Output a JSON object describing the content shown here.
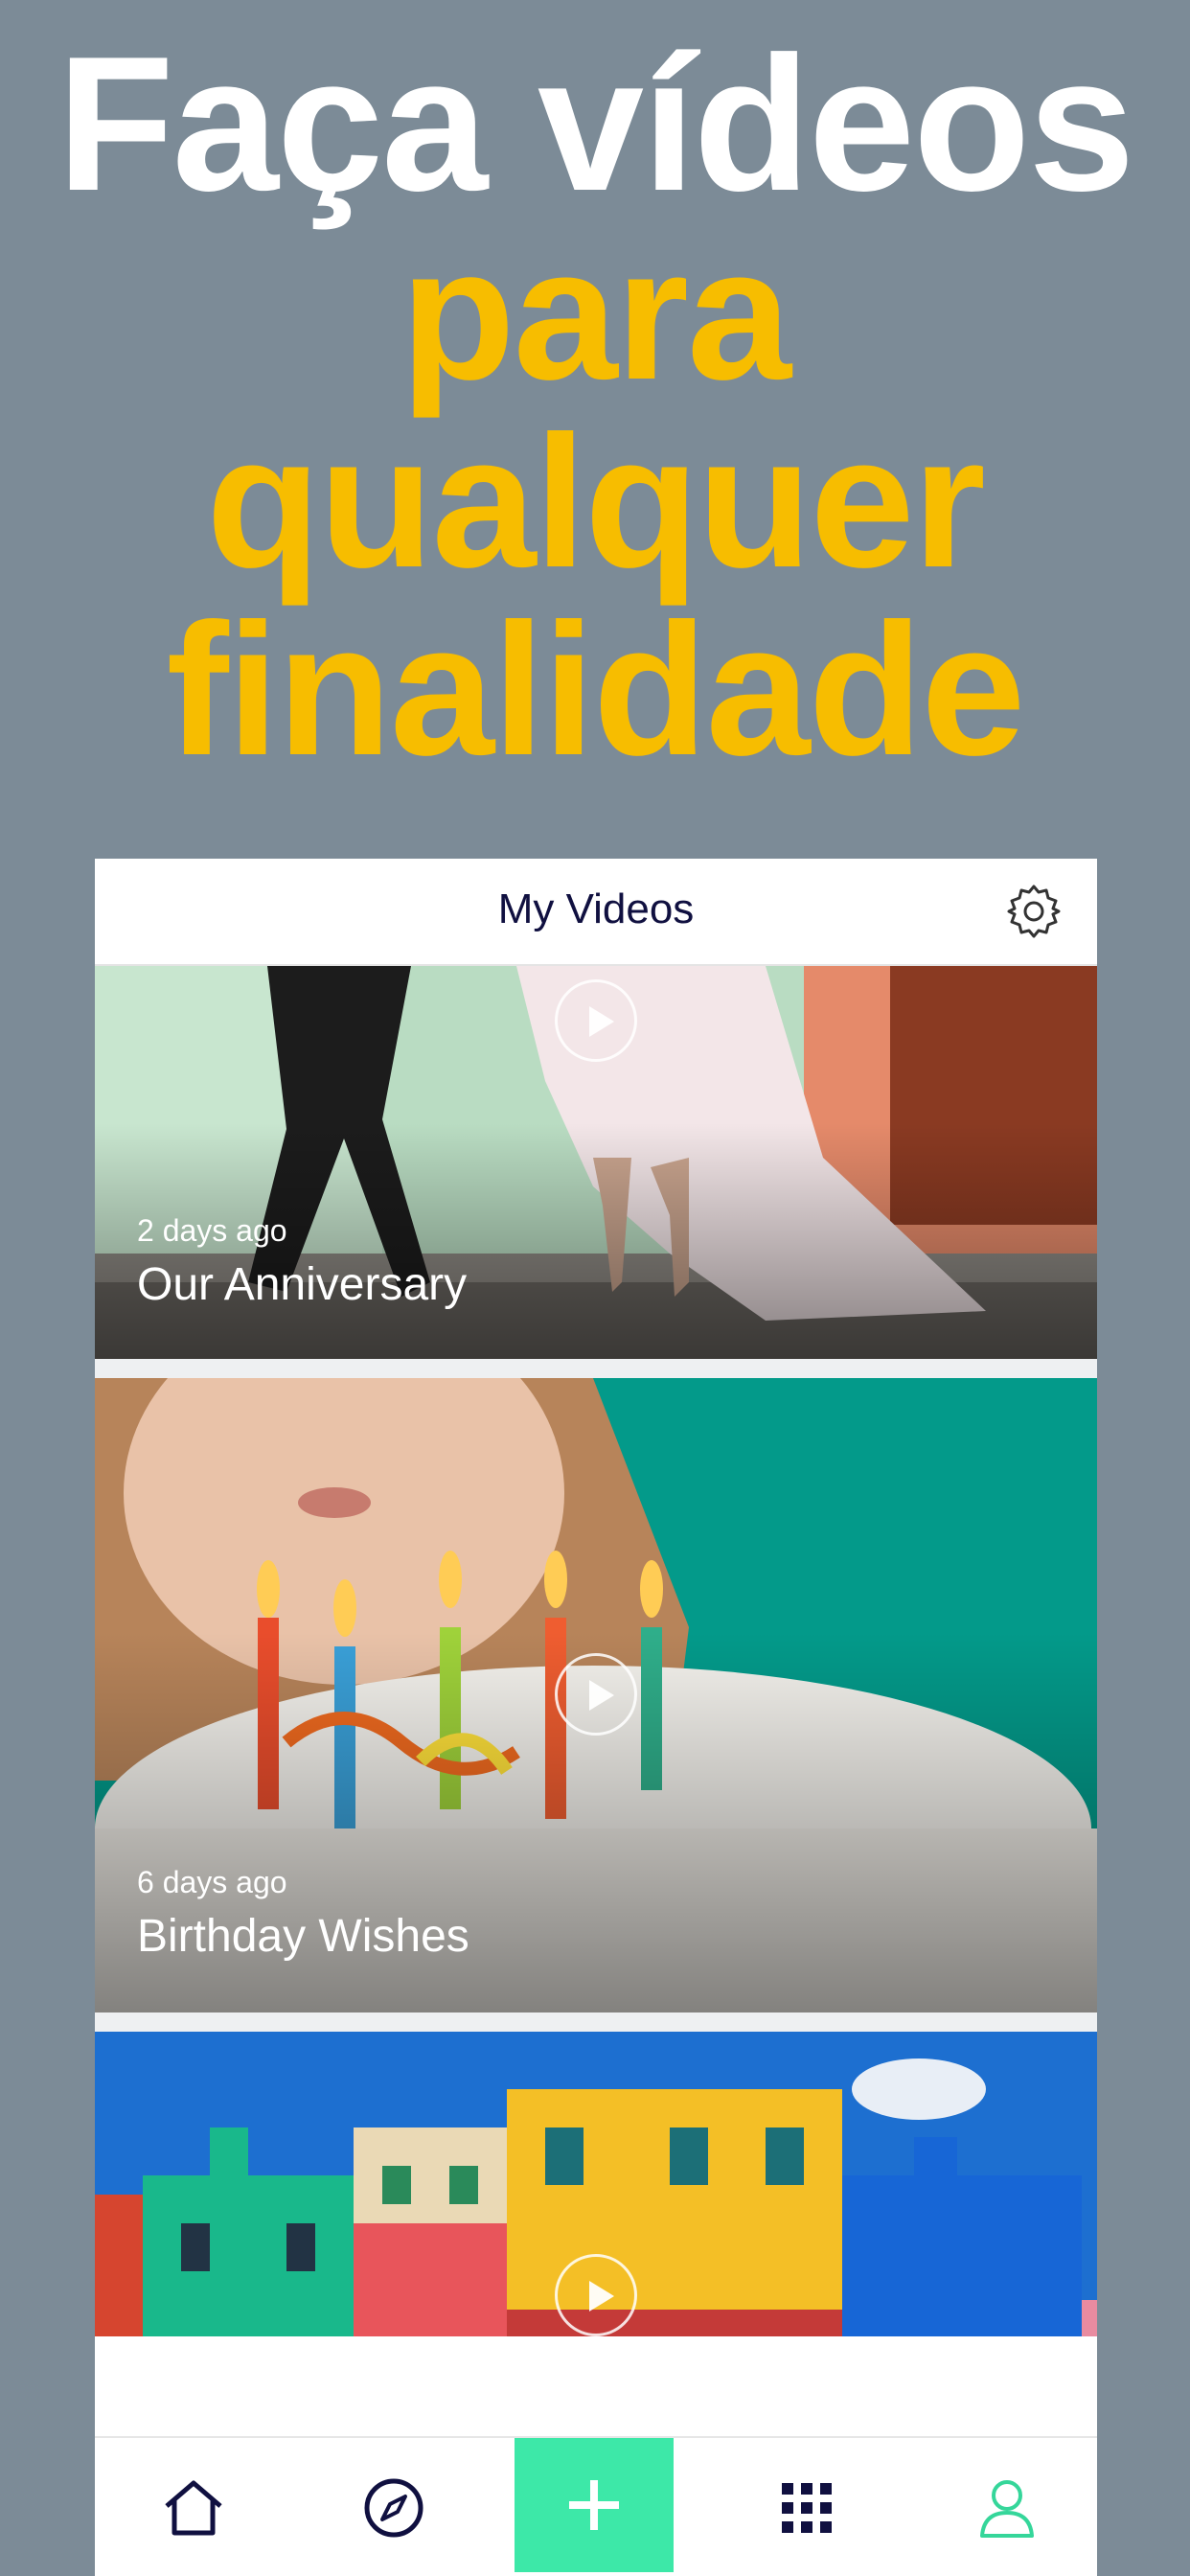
{
  "headline": {
    "line1": "Faça vídeos",
    "line2": "para",
    "line3": "qualquer",
    "line4": "finalidade"
  },
  "colors": {
    "background": "#7c8b97",
    "accent_yellow": "#f7bd00",
    "add_button": "#3de8a8",
    "nav_dark": "#101040"
  },
  "app": {
    "title": "My Videos",
    "settings_icon": "gear-icon"
  },
  "videos": [
    {
      "ago": "2 days ago",
      "title": "Our Anniversary"
    },
    {
      "ago": "6 days ago",
      "title": "Birthday Wishes"
    },
    {
      "ago": "",
      "title": ""
    }
  ],
  "tabs": [
    {
      "icon": "home-icon"
    },
    {
      "icon": "compass-icon"
    },
    {
      "icon": "plus-icon"
    },
    {
      "icon": "grid-icon"
    },
    {
      "icon": "profile-icon"
    }
  ]
}
